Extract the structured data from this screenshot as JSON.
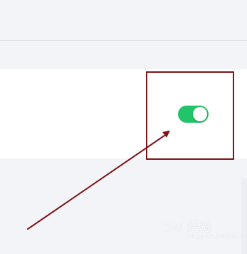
{
  "toggle": {
    "state": "on",
    "color": "#22c46a"
  },
  "annotation": {
    "box_color": "#7d1518",
    "arrow_color": "#7d1518"
  },
  "watermark": {
    "brand": "Bai 经验",
    "sub": "jingyan.baidu.com"
  }
}
